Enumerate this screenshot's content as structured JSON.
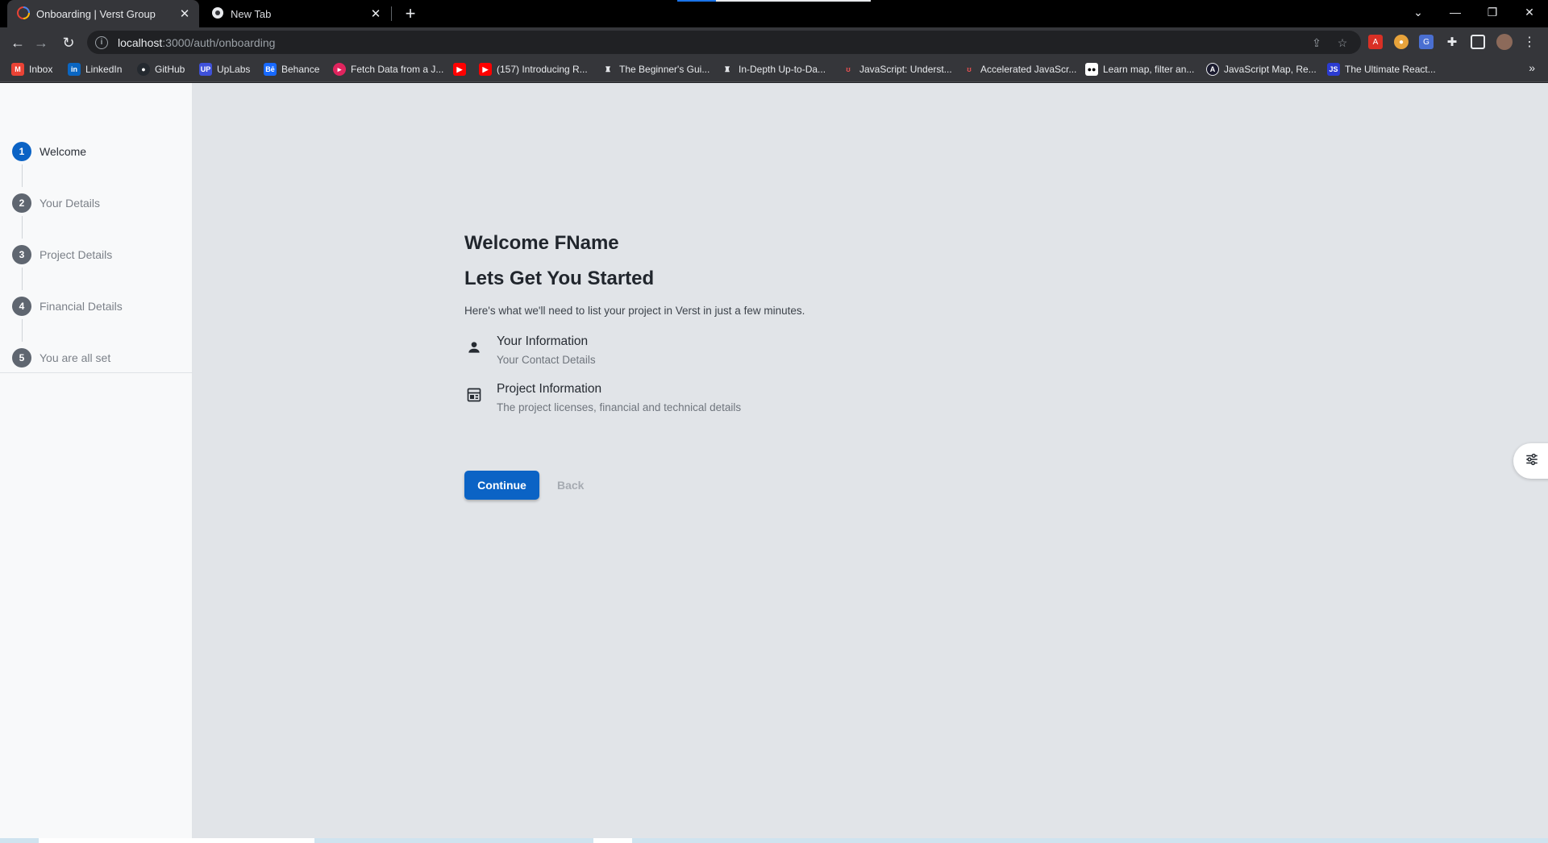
{
  "browser": {
    "tabs": [
      {
        "title": "Onboarding | Verst Group",
        "favicon": "verst-icon"
      },
      {
        "title": "New Tab",
        "favicon": "chrome-icon"
      }
    ],
    "url_host": "localhost",
    "url_path": ":3000/auth/onboarding",
    "bookmarks": [
      {
        "label": "Inbox",
        "icon": "gmail-icon"
      },
      {
        "label": "LinkedIn",
        "icon": "linkedin-icon"
      },
      {
        "label": "GitHub",
        "icon": "github-icon"
      },
      {
        "label": "UpLabs",
        "icon": "uplabs-icon"
      },
      {
        "label": "Behance",
        "icon": "behance-icon"
      },
      {
        "label": "Fetch Data from a J...",
        "icon": "bookmark-icon"
      },
      {
        "label": "",
        "icon": "youtube-icon"
      },
      {
        "label": "(157) Introducing R...",
        "icon": "youtube-icon"
      },
      {
        "label": "The Beginner's Gui...",
        "icon": "bookmark-icon"
      },
      {
        "label": "In-Depth Up-to-Da...",
        "icon": "bookmark-icon"
      },
      {
        "label": "JavaScript: Underst...",
        "icon": "udemy-icon"
      },
      {
        "label": "Accelerated JavaScr...",
        "icon": "udemy-icon"
      },
      {
        "label": "Learn map, filter an...",
        "icon": "medium-icon"
      },
      {
        "label": "JavaScript Map, Re...",
        "icon": "bookmark-icon"
      },
      {
        "label": "The Ultimate React...",
        "icon": "js-icon"
      }
    ]
  },
  "steps": [
    {
      "number": "1",
      "label": "Welcome",
      "active": true
    },
    {
      "number": "2",
      "label": "Your Details",
      "active": false
    },
    {
      "number": "3",
      "label": "Project Details",
      "active": false
    },
    {
      "number": "4",
      "label": "Financial Details",
      "active": false
    },
    {
      "number": "5",
      "label": "You are all set",
      "active": false
    }
  ],
  "main": {
    "heading": "Welcome FName",
    "subheading": "Lets Get You Started",
    "intro": "Here's what we'll need to list your project in Verst in just a few minutes.",
    "items": [
      {
        "title": "Your Information",
        "subtitle": "Your Contact Details",
        "icon": "person-icon"
      },
      {
        "title": "Project Information",
        "subtitle": "The project licenses, financial and technical details",
        "icon": "dashboard-icon"
      }
    ],
    "continue_label": "Continue",
    "back_label": "Back"
  },
  "colors": {
    "primary": "#0b63c5",
    "page_bg": "#e1e4e8",
    "sidebar_bg": "#f8f9fa"
  }
}
